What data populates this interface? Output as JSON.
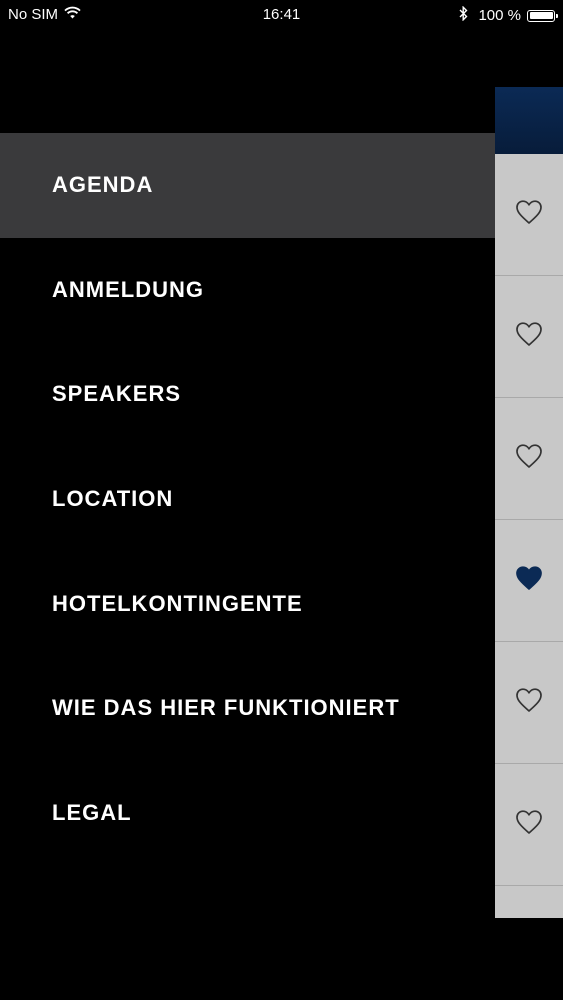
{
  "status_bar": {
    "carrier": "No SIM",
    "time": "16:41",
    "battery_percent": "100 %",
    "battery_level": 1.0,
    "icons": [
      "wifi-icon",
      "bluetooth-icon",
      "battery-icon"
    ]
  },
  "menu": {
    "items": [
      {
        "label": "AGENDA",
        "active": true
      },
      {
        "label": "ANMELDUNG",
        "active": false
      },
      {
        "label": "SPEAKERS",
        "active": false
      },
      {
        "label": "LOCATION",
        "active": false
      },
      {
        "label": "HOTELKONTINGENTE",
        "active": false
      },
      {
        "label": "WIE DAS HIER FUNKTIONIERT",
        "active": false
      },
      {
        "label": "LEGAL",
        "active": false
      }
    ]
  },
  "background_list": {
    "favorites": [
      false,
      false,
      false,
      true,
      false,
      false
    ]
  },
  "colors": {
    "header_blue": "#0b2549",
    "favorite_filled": "#0b2a55",
    "active_menu_bg": "#3a3a3c",
    "list_bg": "#c8c8c8"
  }
}
